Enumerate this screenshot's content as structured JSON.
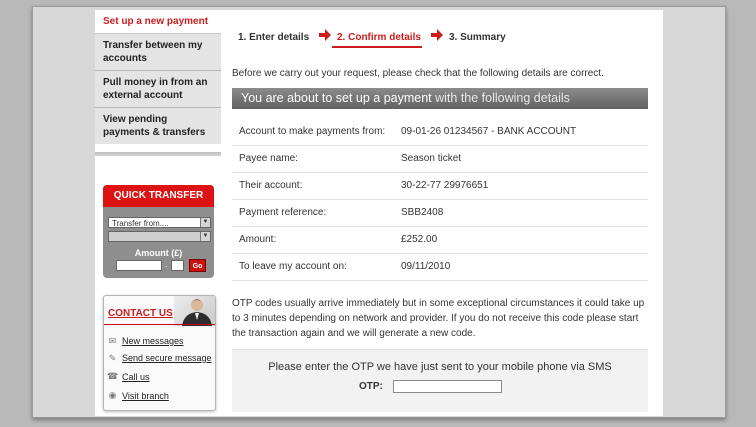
{
  "nav": {
    "items": [
      {
        "label": "Set up a new payment"
      },
      {
        "label": "Transfer between my accounts"
      },
      {
        "label": "Pull money in from an external account"
      },
      {
        "label": "View pending payments & transfers"
      }
    ]
  },
  "quick_transfer": {
    "title": "QUICK TRANSFER",
    "from_placeholder": "Transfer from....",
    "amount_label": "Amount (£)",
    "decimal": ".",
    "go_label": "Go"
  },
  "contact": {
    "title": "CONTACT US",
    "links": [
      {
        "label": "New messages",
        "icon": "envelope-icon"
      },
      {
        "label": "Send secure message",
        "icon": "pencil-icon"
      },
      {
        "label": "Call us",
        "icon": "phone-icon"
      },
      {
        "label": "Visit branch",
        "icon": "globe-icon"
      }
    ]
  },
  "steps": [
    {
      "label": "1. Enter details"
    },
    {
      "label": "2. Confirm details",
      "active": true
    },
    {
      "label": "3. Summary"
    }
  ],
  "intro": "Before we carry out your request, please check that the following details are correct.",
  "banner": {
    "strong": "You are about to set up a payment",
    "rest": " with the following details"
  },
  "details": [
    {
      "label": "Account to make payments from:",
      "value": "09-01-26 01234567 - BANK ACCOUNT"
    },
    {
      "label": "Payee name:",
      "value": "Season ticket"
    },
    {
      "label": "Their account:",
      "value": "30-22-77 29976651"
    },
    {
      "label": "Payment reference:",
      "value": "SBB2408"
    },
    {
      "label": "Amount:",
      "value": "£252.00"
    },
    {
      "label": "To leave my account on:",
      "value": "09/11/2010"
    }
  ],
  "otp": {
    "info": "OTP codes usually arrive immediately but in some exceptional circumstances it could take up to 3 minutes depending on network and provider. If you do not receive this code please start the transaction again and we will generate a new code.",
    "prompt": "Please enter the OTP we have just sent to your mobile phone via SMS",
    "label": "OTP:",
    "value": ""
  },
  "colors": {
    "accent": "#cc1c1c",
    "banner": "#717171"
  }
}
